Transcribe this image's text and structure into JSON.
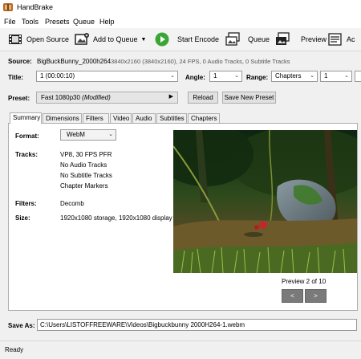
{
  "window": {
    "title": "HandBrake"
  },
  "menu": [
    "File",
    "Tools",
    "Presets",
    "Queue",
    "Help"
  ],
  "toolbar": {
    "open_source": "Open Source",
    "add_to_queue": "Add to Queue",
    "start_encode": "Start Encode",
    "queue": "Queue",
    "preview": "Preview",
    "activity": "Ac"
  },
  "source": {
    "label": "Source:",
    "name": "BigBuckBunny_2000h264",
    "info": "3840x2160 (3840x2160), 24 FPS, 0 Audio Tracks, 0 Subtitle Tracks"
  },
  "title_row": {
    "title_label": "Title:",
    "title_value": "1 (00:00:10)",
    "angle_label": "Angle:",
    "angle_value": "1",
    "range_label": "Range:",
    "range_value": "Chapters",
    "range_start": "1"
  },
  "preset": {
    "label": "Preset:",
    "value": "Fast 1080p30",
    "modified": "(Modified)",
    "reload": "Reload",
    "save_new": "Save New Preset"
  },
  "tabs": [
    "Summary",
    "Dimensions",
    "Filters",
    "Video",
    "Audio",
    "Subtitles",
    "Chapters"
  ],
  "summary": {
    "format_label": "Format:",
    "format_value": "WebM",
    "tracks_label": "Tracks:",
    "tracks": [
      "VP8, 30 FPS PFR",
      "No Audio Tracks",
      "No Subtitle Tracks",
      "Chapter Markers"
    ],
    "filters_label": "Filters:",
    "filters_value": "Decomb",
    "size_label": "Size:",
    "size_value": "1920x1080 storage, 1920x1080 display",
    "preview_caption": "Preview 2 of 10",
    "prev": "<",
    "next": ">"
  },
  "save_as": {
    "label": "Save As:",
    "path": "C:\\Users\\LISTOFFREEWARE\\Videos\\Bigbuckbunny 2000H264-1.webm"
  },
  "status": "Ready",
  "colors": {
    "accent_green": "#3aa635",
    "toolbar_bg": "#f3f3f3"
  }
}
